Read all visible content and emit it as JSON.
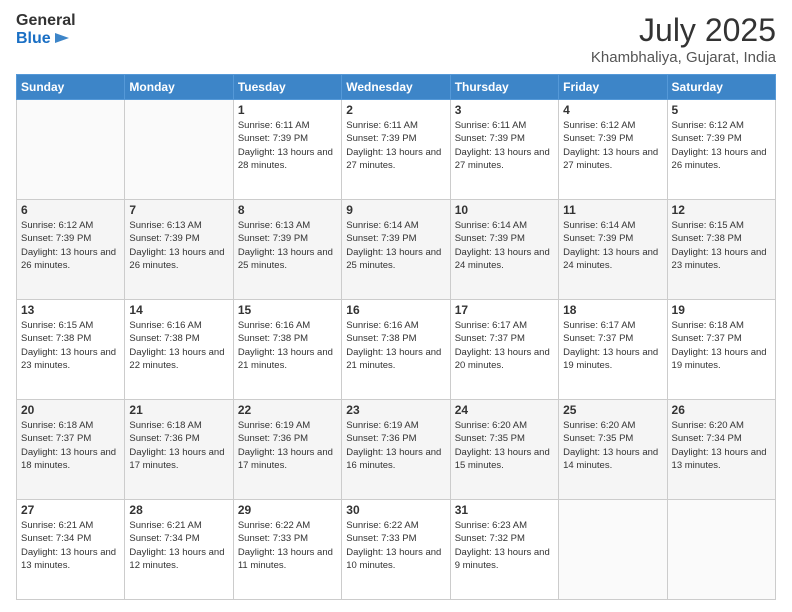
{
  "header": {
    "logo_line1": "General",
    "logo_line2": "Blue",
    "month_year": "July 2025",
    "location": "Khambhaliya, Gujarat, India"
  },
  "days_of_week": [
    "Sunday",
    "Monday",
    "Tuesday",
    "Wednesday",
    "Thursday",
    "Friday",
    "Saturday"
  ],
  "weeks": [
    [
      {
        "day": "",
        "info": ""
      },
      {
        "day": "",
        "info": ""
      },
      {
        "day": "1",
        "info": "Sunrise: 6:11 AM\nSunset: 7:39 PM\nDaylight: 13 hours and 28 minutes."
      },
      {
        "day": "2",
        "info": "Sunrise: 6:11 AM\nSunset: 7:39 PM\nDaylight: 13 hours and 27 minutes."
      },
      {
        "day": "3",
        "info": "Sunrise: 6:11 AM\nSunset: 7:39 PM\nDaylight: 13 hours and 27 minutes."
      },
      {
        "day": "4",
        "info": "Sunrise: 6:12 AM\nSunset: 7:39 PM\nDaylight: 13 hours and 27 minutes."
      },
      {
        "day": "5",
        "info": "Sunrise: 6:12 AM\nSunset: 7:39 PM\nDaylight: 13 hours and 26 minutes."
      }
    ],
    [
      {
        "day": "6",
        "info": "Sunrise: 6:12 AM\nSunset: 7:39 PM\nDaylight: 13 hours and 26 minutes."
      },
      {
        "day": "7",
        "info": "Sunrise: 6:13 AM\nSunset: 7:39 PM\nDaylight: 13 hours and 26 minutes."
      },
      {
        "day": "8",
        "info": "Sunrise: 6:13 AM\nSunset: 7:39 PM\nDaylight: 13 hours and 25 minutes."
      },
      {
        "day": "9",
        "info": "Sunrise: 6:14 AM\nSunset: 7:39 PM\nDaylight: 13 hours and 25 minutes."
      },
      {
        "day": "10",
        "info": "Sunrise: 6:14 AM\nSunset: 7:39 PM\nDaylight: 13 hours and 24 minutes."
      },
      {
        "day": "11",
        "info": "Sunrise: 6:14 AM\nSunset: 7:39 PM\nDaylight: 13 hours and 24 minutes."
      },
      {
        "day": "12",
        "info": "Sunrise: 6:15 AM\nSunset: 7:38 PM\nDaylight: 13 hours and 23 minutes."
      }
    ],
    [
      {
        "day": "13",
        "info": "Sunrise: 6:15 AM\nSunset: 7:38 PM\nDaylight: 13 hours and 23 minutes."
      },
      {
        "day": "14",
        "info": "Sunrise: 6:16 AM\nSunset: 7:38 PM\nDaylight: 13 hours and 22 minutes."
      },
      {
        "day": "15",
        "info": "Sunrise: 6:16 AM\nSunset: 7:38 PM\nDaylight: 13 hours and 21 minutes."
      },
      {
        "day": "16",
        "info": "Sunrise: 6:16 AM\nSunset: 7:38 PM\nDaylight: 13 hours and 21 minutes."
      },
      {
        "day": "17",
        "info": "Sunrise: 6:17 AM\nSunset: 7:37 PM\nDaylight: 13 hours and 20 minutes."
      },
      {
        "day": "18",
        "info": "Sunrise: 6:17 AM\nSunset: 7:37 PM\nDaylight: 13 hours and 19 minutes."
      },
      {
        "day": "19",
        "info": "Sunrise: 6:18 AM\nSunset: 7:37 PM\nDaylight: 13 hours and 19 minutes."
      }
    ],
    [
      {
        "day": "20",
        "info": "Sunrise: 6:18 AM\nSunset: 7:37 PM\nDaylight: 13 hours and 18 minutes."
      },
      {
        "day": "21",
        "info": "Sunrise: 6:18 AM\nSunset: 7:36 PM\nDaylight: 13 hours and 17 minutes."
      },
      {
        "day": "22",
        "info": "Sunrise: 6:19 AM\nSunset: 7:36 PM\nDaylight: 13 hours and 17 minutes."
      },
      {
        "day": "23",
        "info": "Sunrise: 6:19 AM\nSunset: 7:36 PM\nDaylight: 13 hours and 16 minutes."
      },
      {
        "day": "24",
        "info": "Sunrise: 6:20 AM\nSunset: 7:35 PM\nDaylight: 13 hours and 15 minutes."
      },
      {
        "day": "25",
        "info": "Sunrise: 6:20 AM\nSunset: 7:35 PM\nDaylight: 13 hours and 14 minutes."
      },
      {
        "day": "26",
        "info": "Sunrise: 6:20 AM\nSunset: 7:34 PM\nDaylight: 13 hours and 13 minutes."
      }
    ],
    [
      {
        "day": "27",
        "info": "Sunrise: 6:21 AM\nSunset: 7:34 PM\nDaylight: 13 hours and 13 minutes."
      },
      {
        "day": "28",
        "info": "Sunrise: 6:21 AM\nSunset: 7:34 PM\nDaylight: 13 hours and 12 minutes."
      },
      {
        "day": "29",
        "info": "Sunrise: 6:22 AM\nSunset: 7:33 PM\nDaylight: 13 hours and 11 minutes."
      },
      {
        "day": "30",
        "info": "Sunrise: 6:22 AM\nSunset: 7:33 PM\nDaylight: 13 hours and 10 minutes."
      },
      {
        "day": "31",
        "info": "Sunrise: 6:23 AM\nSunset: 7:32 PM\nDaylight: 13 hours and 9 minutes."
      },
      {
        "day": "",
        "info": ""
      },
      {
        "day": "",
        "info": ""
      }
    ]
  ]
}
